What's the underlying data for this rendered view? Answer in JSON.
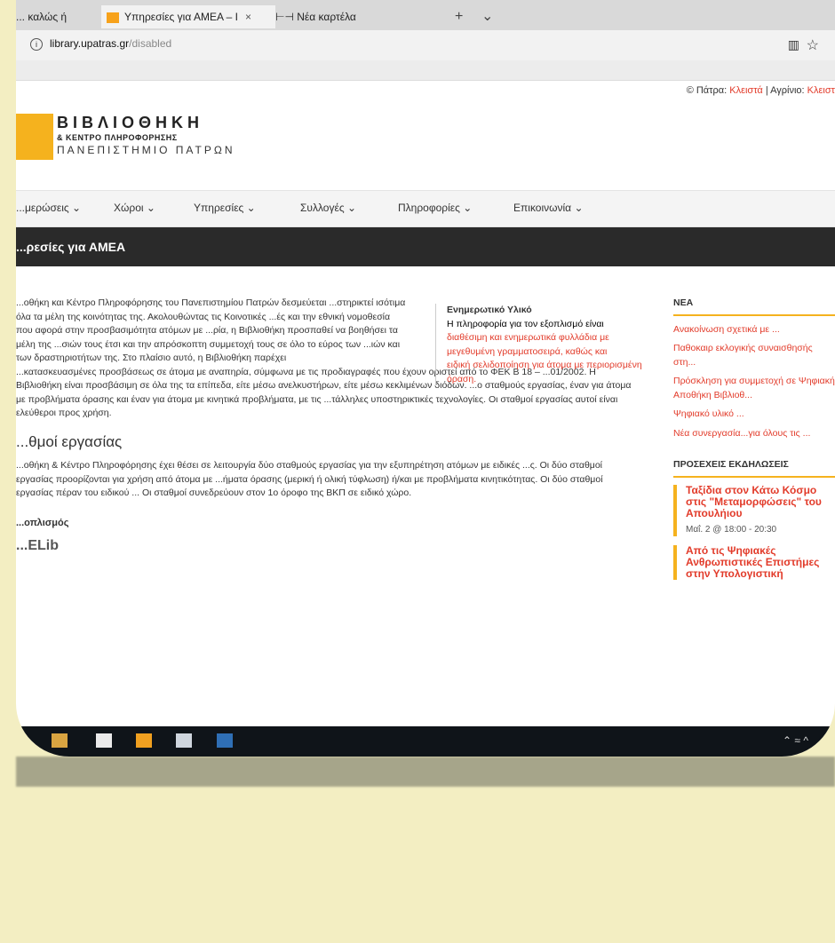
{
  "browser": {
    "tabs": [
      {
        "label": "... καλώς ή"
      },
      {
        "label": "Υπηρεσίες για ΑΜΕΑ – Ι",
        "close": "×"
      },
      {
        "label": "Νέα καρτέλα"
      }
    ],
    "new_tab": "+",
    "tab_menu": "⌄",
    "url_host": "library.upatras.gr",
    "url_path": "/disabled",
    "info_icon": "i",
    "reader_icon": "▥",
    "star_icon": "☆"
  },
  "site": {
    "location_label": "© Πάτρα:",
    "location_value": "Κλειστά",
    "location_sep": "| Αγρίνιο:",
    "location_value2": "Κλειστ",
    "logo_line1": "ΒΙΒΛΙΟΘΗΚΗ",
    "logo_line2": "& ΚΕΝΤΡΟ ΠΛΗΡΟΦΟΡΗΣΗΣ",
    "logo_line3": "ΠΑΝΕΠΙΣΤΗΜΙΟ ΠΑΤΡΩΝ",
    "nav": [
      "...μερώσεις ⌄",
      "Χώροι ⌄",
      "Υπηρεσίες ⌄",
      "Συλλογές ⌄",
      "Πληροφορίες ⌄",
      "Επικοινωνία ⌄"
    ],
    "page_title": "...ρεσίες για ΑΜΕΑ"
  },
  "content": {
    "para1": "...οθήκη και Κέντρο Πληροφόρησης του Πανεπιστημίου Πατρών δεσμεύεται ...στηρικτεί ισότιμα όλα τα μέλη της κοινότητας της. Ακολουθώντας τις Κοινοτικές ...ές και την εθνική νομοθεσία που αφορά στην προσβασιμότητα ατόμων με ...ρία, η Βιβλιοθήκη προσπαθεί να βοηθήσει τα μέλη της ...σιών τους έτσι και την απρόσκοπτη συμμετοχή τους σε όλο το εύρος των ...ιών και των δραστηριοτήτων της. Στο πλαίσιο αυτό, η Βιβλιοθήκη παρέχει",
    "para2": "...κατασκευασμένες προσβάσεως σε άτομα με αναπηρία, σύμφωνα με τις προδιαγραφές που έχουν οριστεί από το ΦΕΚ Β 18 – ...01/2002. Η Βιβλιοθήκη είναι προσβάσιμη σε όλα της τα επίπεδα, είτε μέσω ανελκυστήρων, είτε μέσω κεκλιμένων διόδων. ...ο σταθμούς εργασίας, έναν για άτομα με προβλήματα όρασης και έναν για άτομα με κινητικά προβλήματα, με τις ...τάλληλες υποστηρικτικές τεχνολογίες. Οι σταθμοί εργασίας αυτοί είναι ελεύθεροι προς χρήση.",
    "h_workstations": "...θμοί εργασίας",
    "para3": "...οθήκη & Κέντρο Πληροφόρησης έχει θέσει σε λειτουργία δύο σταθμούς εργασίας για την εξυπηρέτηση ατόμων με ειδικές ...ς. Οι δύο σταθμοί εργασίας προορίζονται για χρήση από άτομα με ...ήματα όρασης (μερική ή ολική τύφλωση) ή/και με προβλήματα κινητικότητας. Οι δύο σταθμοί εργασίας πέραν του ειδικού ... Οι σταθμοί συνεδρεύουν στον 1ο όροφο της ΒΚΠ σε ειδικό χώρο.",
    "h_equipment": "...οπλισμός",
    "h_elib": "...ELib",
    "aside_title": "Ενημερωτικό Υλικό",
    "aside_text1": "Η πληροφορία για τον εξοπλισμό είναι",
    "aside_text2": "διαθέσιμη και ενημερωτικά φυλλάδια με μεγεθυμένη γραμματοσειρά, καθώς και",
    "aside_text3": "ειδική σελιδοποίηση για άτομα με περιορισμένη όραση."
  },
  "sidebar": {
    "news_title": "ΝΕΑ",
    "news": [
      "Ανακοίνωση σχετικά με ...",
      "Παθοκαιρ εκλογικής συναισθησής στη...",
      "Πρόσκληση για συμμετοχή σε Ψηφιακή Αποθήκη Βιβλιοθ...",
      "Ψηφιακό υλικό ...",
      "Νέα συνεργασία...για όλους τις ..."
    ],
    "events_title": "ΠΡΟΣΕΧΕΙΣ ΕΚΔΗΛΩΣΕΙΣ",
    "events": [
      {
        "title": "Ταξίδια στον Κάτω Κόσμο στις \"Μεταμορφώσεις\" του Απουλήιου",
        "date": "Μαΐ. 2 @ 18:00 - 20:30"
      },
      {
        "title": "Από τις Ψηφιακές Ανθρωπιστικές Επιστήμες στην Υπολογιστική",
        "date": ""
      }
    ]
  },
  "taskbar": {
    "tray_text": "⌃ ≈ ^"
  },
  "colors": {
    "accent": "#f5b21e",
    "link": "#e23b2a",
    "titlebar": "#2a2a2a",
    "taskbar": "#0f1419"
  }
}
